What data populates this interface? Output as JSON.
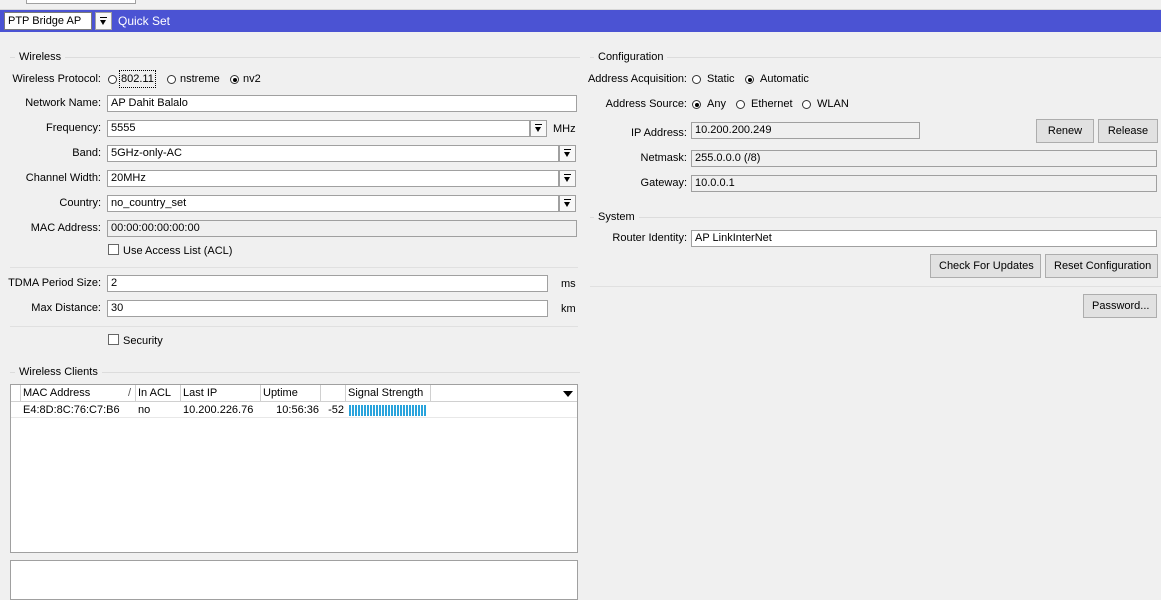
{
  "header": {
    "mode": "PTP Bridge AP",
    "title": "Quick Set"
  },
  "wireless": {
    "group_title": "Wireless",
    "protocol_label": "Wireless Protocol:",
    "protocol_options": [
      "802.11",
      "nstreme",
      "nv2"
    ],
    "protocol_selected": "nv2",
    "network_name_label": "Network Name:",
    "network_name": "AP Dahit Balalo",
    "frequency_label": "Frequency:",
    "frequency": "5555",
    "frequency_unit": "MHz",
    "band_label": "Band:",
    "band": "5GHz-only-AC",
    "channel_width_label": "Channel Width:",
    "channel_width": "20MHz",
    "country_label": "Country:",
    "country": "no_country_set",
    "mac_label": "MAC Address:",
    "mac": "00:00:00:00:00:00",
    "acl_label": "Use Access List (ACL)",
    "tdma_label": "TDMA Period Size:",
    "tdma": "2",
    "tdma_unit": "ms",
    "max_distance_label": "Max Distance:",
    "max_distance": "30",
    "max_distance_unit": "km",
    "security_label": "Security"
  },
  "clients": {
    "group_title": "Wireless Clients",
    "columns": [
      "MAC Address",
      "In ACL",
      "Last IP",
      "Uptime",
      "",
      "Signal Strength"
    ],
    "rows": [
      {
        "mac": "E4:8D:8C:76:C7:B6",
        "in_acl": "no",
        "last_ip": "10.200.226.76",
        "uptime": "10:56:36",
        "signal": "-52",
        "signal_strength_percent": 48
      }
    ]
  },
  "configuration": {
    "group_title": "Configuration",
    "acq_label": "Address Acquisition:",
    "acq_options": [
      "Static",
      "Automatic"
    ],
    "acq_selected": "Automatic",
    "source_label": "Address Source:",
    "source_options": [
      "Any",
      "Ethernet",
      "WLAN"
    ],
    "source_selected": "Any",
    "ip_label": "IP Address:",
    "ip": "10.200.200.249",
    "renew_label": "Renew",
    "release_label": "Release",
    "netmask_label": "Netmask:",
    "netmask": "255.0.0.0 (/8)",
    "gateway_label": "Gateway:",
    "gateway": "10.0.0.1"
  },
  "system": {
    "group_title": "System",
    "identity_label": "Router Identity:",
    "identity": "AP LinkInterNet",
    "check_updates_label": "Check For Updates",
    "reset_config_label": "Reset Configuration",
    "password_label": "Password..."
  },
  "colors": {
    "header_bar": "#4b53d3",
    "signal_bar": "#2aa4dc"
  }
}
